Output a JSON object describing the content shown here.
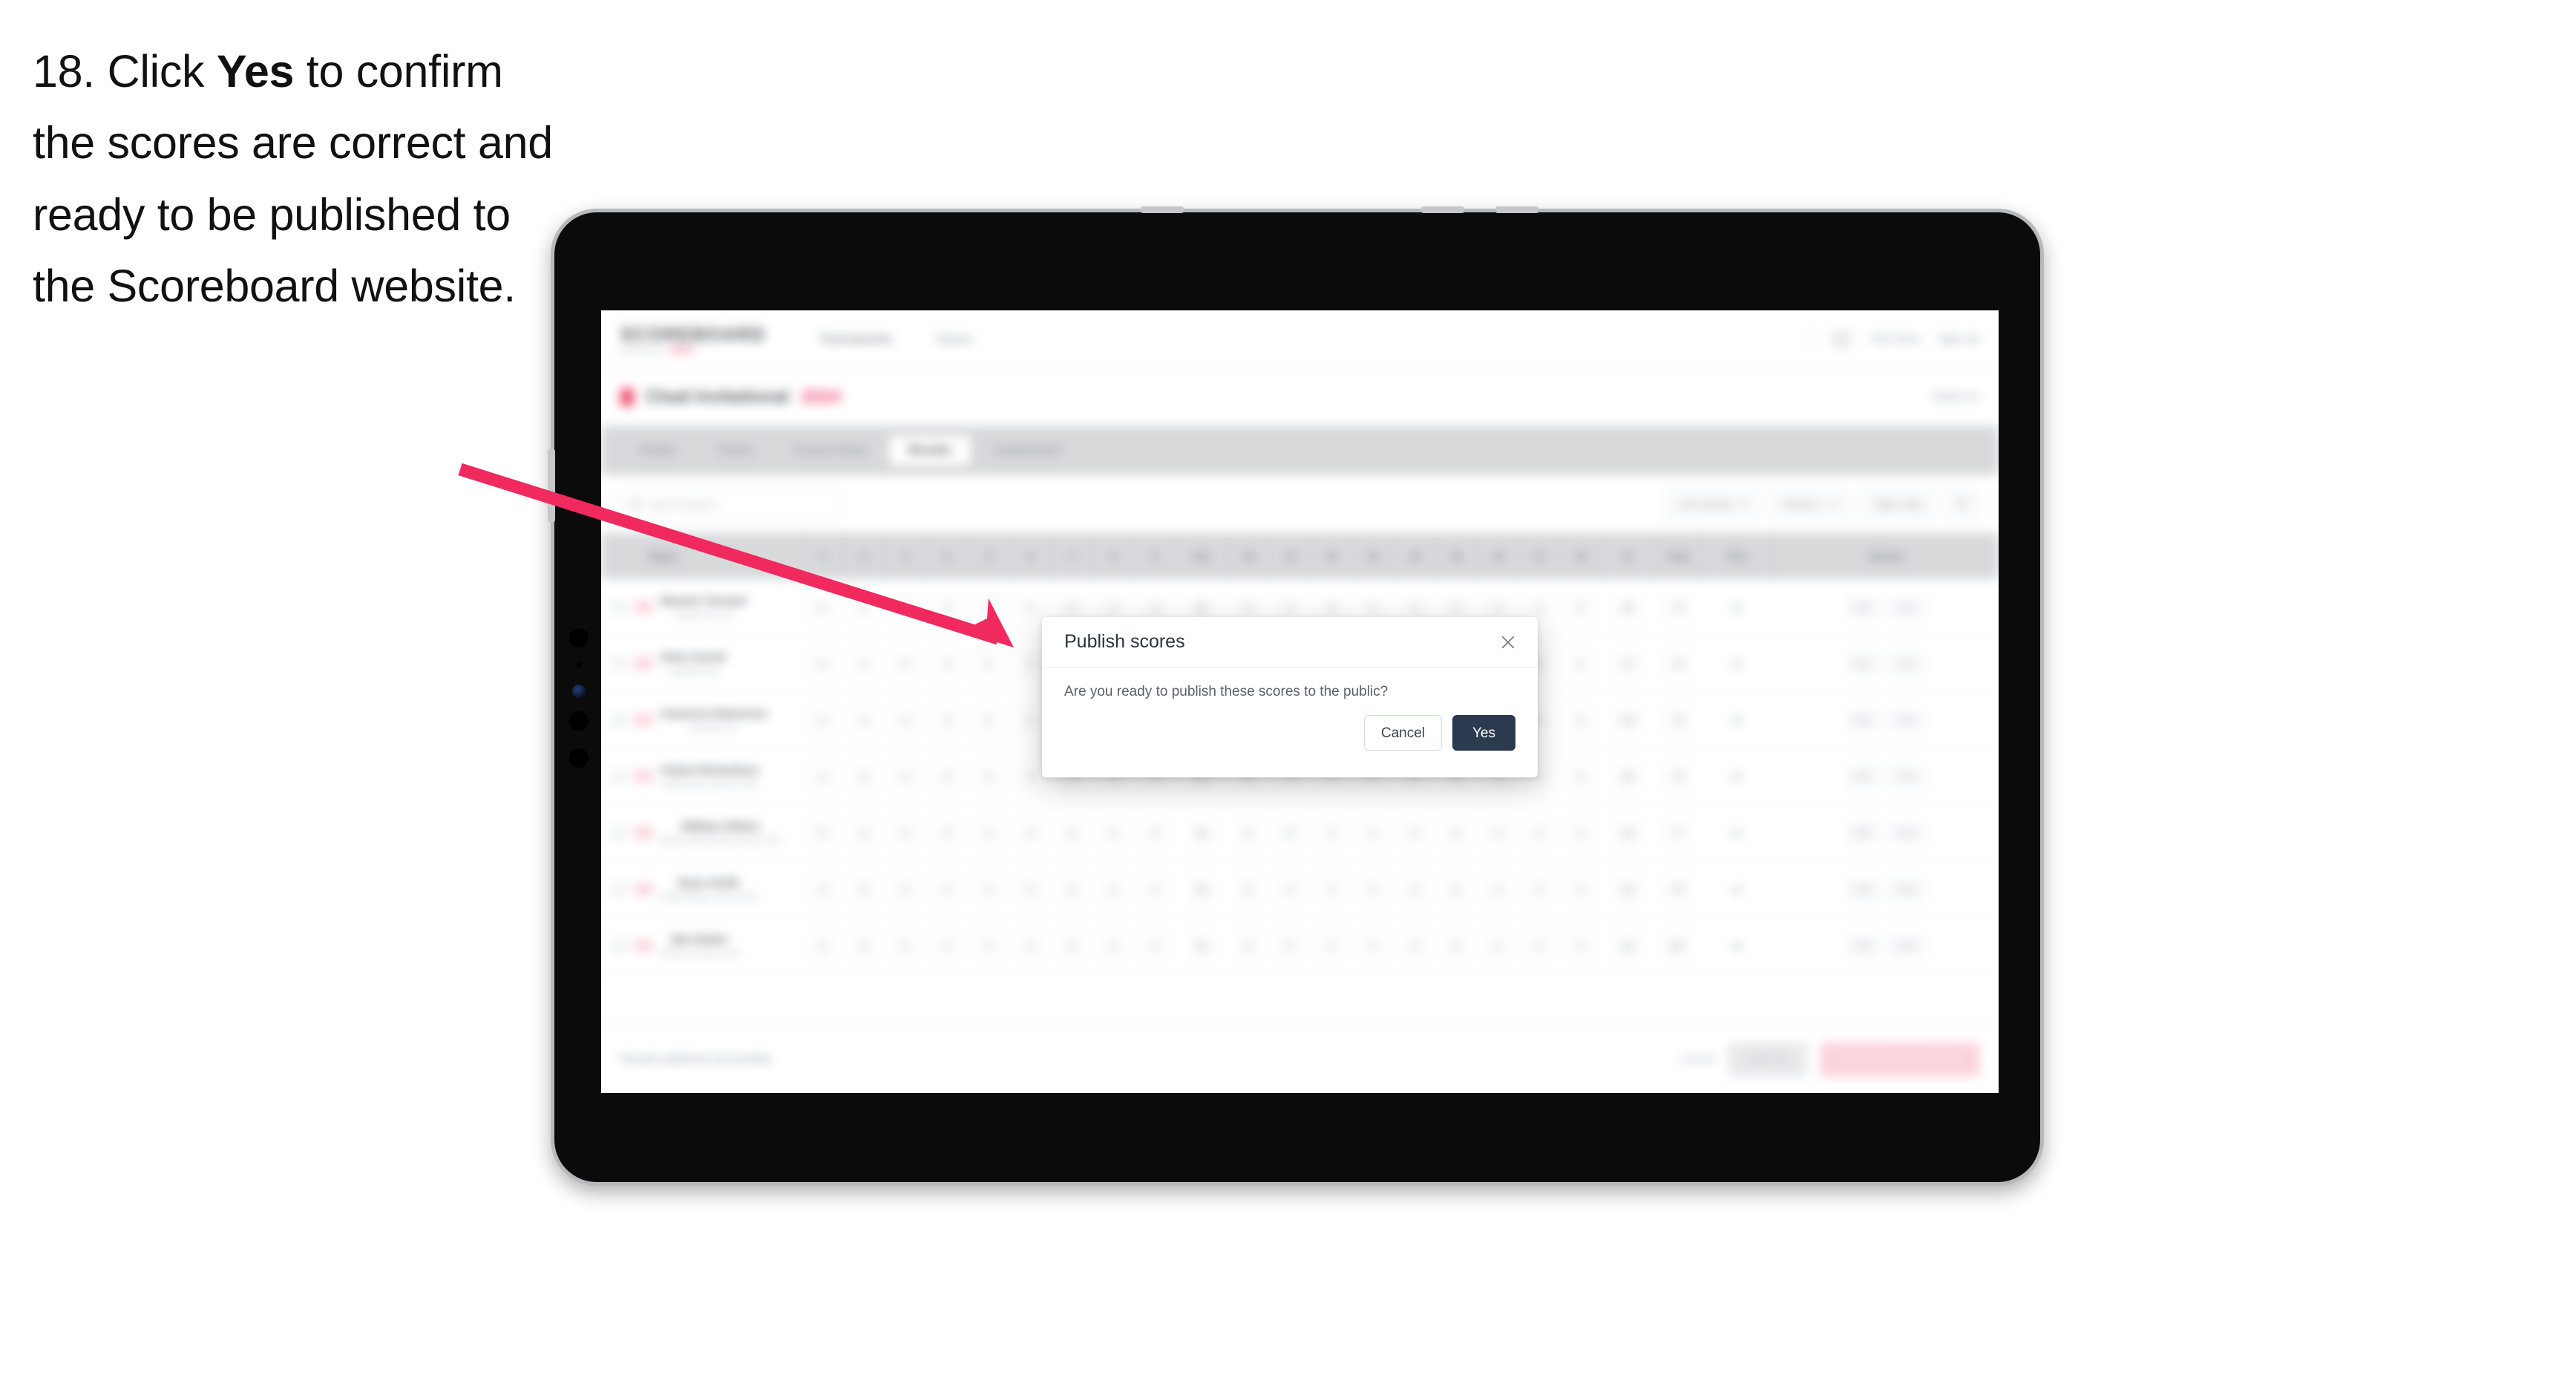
{
  "instruction": {
    "step_number": "18.",
    "text_before": "Click ",
    "emphasis": "Yes",
    "text_after": " to confirm the scores are correct and ready to be published to the Scoreboard website."
  },
  "colors": {
    "arrow": "#F0295E",
    "primary_button": "#2C3A50",
    "accent_pink": "#EF4268",
    "device_body": "#0B0B0B",
    "device_bezel": "#B8B9BA"
  },
  "modal": {
    "title": "Publish scores",
    "body": "Are you ready to publish these scores to the public?",
    "close_icon": "close-icon",
    "cancel_label": "Cancel",
    "confirm_label": "Yes"
  },
  "app": {
    "brand": {
      "name": "SCOREBOARD",
      "subtitle": "powered by",
      "tag": "GOLF"
    },
    "nav": [
      {
        "label": "Tournaments"
      },
      {
        "label": "Teams"
      }
    ],
    "header_right": {
      "avatar_icon": "user-avatar-icon",
      "user_label": "Tom Gore",
      "signout_label": "Sign out"
    },
    "title_row": {
      "flag_icon": "flag-icon",
      "name": "Chad Invitational",
      "year": "2024",
      "meta": "Week 12"
    },
    "tabs": [
      {
        "label": "Details",
        "active": false
      },
      {
        "label": "Teams",
        "active": false
      },
      {
        "label": "Course Setup",
        "active": false
      },
      {
        "label": "Results",
        "active": true
      },
      {
        "label": "Leaderboard",
        "active": false
      }
    ],
    "toolbar": {
      "search_placeholder": "Search players",
      "search_icon": "search-icon",
      "filters": [
        {
          "label": "All Courses"
        },
        {
          "label": "Round 1"
        },
        {
          "label": "Table Only"
        }
      ],
      "settings_icon": "settings-icon"
    },
    "table": {
      "columns": [
        "Player",
        "1",
        "2",
        "3",
        "4",
        "5",
        "6",
        "7",
        "8",
        "9",
        "Out",
        "10",
        "11",
        "12",
        "13",
        "14",
        "15",
        "16",
        "17",
        "18",
        "In",
        "Total",
        "Thru",
        "Actions"
      ],
      "rows": [
        {
          "checkbox": "row-checkbox",
          "flag": "country-flag",
          "name": "Maxime Tennant",
          "club": "Castle Cove GC",
          "front": [
            "4",
            "5",
            "4",
            "3",
            "5",
            "4",
            "4",
            "3",
            "4"
          ],
          "out": "36",
          "back": [
            "4",
            "4",
            "5",
            "3",
            "4",
            "5",
            "4",
            "3",
            "4"
          ],
          "in": "36",
          "total": "72",
          "thru": "18",
          "actions": [
            "Edit",
            "View"
          ]
        },
        {
          "checkbox": "row-checkbox",
          "flag": "country-flag",
          "name": "Peter Farrell",
          "club": "Lakeside Golf",
          "front": [
            "4",
            "4",
            "5",
            "4",
            "4",
            "4",
            "5",
            "3",
            "4"
          ],
          "out": "37",
          "back": [
            "5",
            "4",
            "4",
            "4",
            "4",
            "4",
            "4",
            "4",
            "4"
          ],
          "in": "37",
          "total": "74",
          "thru": "18",
          "actions": [
            "Edit",
            "View"
          ]
        },
        {
          "checkbox": "row-checkbox",
          "flag": "country-flag",
          "name": "Cameron Robertson",
          "club": "Pinehurst CC",
          "front": [
            "5",
            "4",
            "4",
            "4",
            "5",
            "4",
            "4",
            "4",
            "4"
          ],
          "out": "38",
          "back": [
            "4",
            "5",
            "4",
            "4",
            "4",
            "5",
            "4",
            "4",
            "4"
          ],
          "in": "38",
          "total": "76",
          "thru": "18",
          "actions": [
            "Edit",
            "View"
          ]
        },
        {
          "checkbox": "row-checkbox",
          "flag": "country-flag",
          "name": "Calum Richardson",
          "club": "North Shore Country Club",
          "front": [
            "4",
            "5",
            "4",
            "4",
            "4",
            "4",
            "4",
            "5",
            "4"
          ],
          "out": "38",
          "back": [
            "4",
            "4",
            "5",
            "4",
            "4",
            "4",
            "5",
            "4",
            "4"
          ],
          "in": "38",
          "total": "76",
          "thru": "18",
          "actions": [
            "Edit",
            "View"
          ]
        },
        {
          "checkbox": "row-checkbox",
          "flag": "country-flag",
          "name": "William Gilbert",
          "club": "Royal Lakes Golf & Country Club",
          "front": [
            "5",
            "4",
            "4",
            "5",
            "4",
            "4",
            "4",
            "4",
            "5"
          ],
          "out": "39",
          "back": [
            "4",
            "5",
            "4",
            "4",
            "5",
            "4",
            "4",
            "4",
            "4"
          ],
          "in": "38",
          "total": "77",
          "thru": "18",
          "actions": [
            "Edit",
            "View"
          ]
        },
        {
          "checkbox": "row-checkbox",
          "flag": "country-flag",
          "name": "Ryan Smith",
          "club": "Sandy Ridge Country Club",
          "front": [
            "4",
            "5",
            "5",
            "4",
            "4",
            "5",
            "4",
            "4",
            "4"
          ],
          "out": "39",
          "back": [
            "5",
            "4",
            "4",
            "5",
            "4",
            "4",
            "4",
            "5",
            "4"
          ],
          "in": "39",
          "total": "78",
          "thru": "18",
          "actions": [
            "Edit",
            "View"
          ]
        },
        {
          "checkbox": "row-checkbox",
          "flag": "country-flag",
          "name": "Ben Butler",
          "club": "Hillcrest Country Club",
          "front": [
            "5",
            "4",
            "5",
            "4",
            "5",
            "4",
            "5",
            "4",
            "4"
          ],
          "out": "40",
          "back": [
            "4",
            "5",
            "4",
            "5",
            "4",
            "5",
            "4",
            "4",
            "5"
          ],
          "in": "40",
          "total": "80",
          "thru": "18",
          "actions": [
            "Edit",
            "View"
          ]
        }
      ]
    },
    "bottom_bar": {
      "note": "Results published successfully",
      "cancel_label": "Cancel",
      "save_label": "Save All",
      "publish_label": "Publish Scores to Public"
    }
  }
}
